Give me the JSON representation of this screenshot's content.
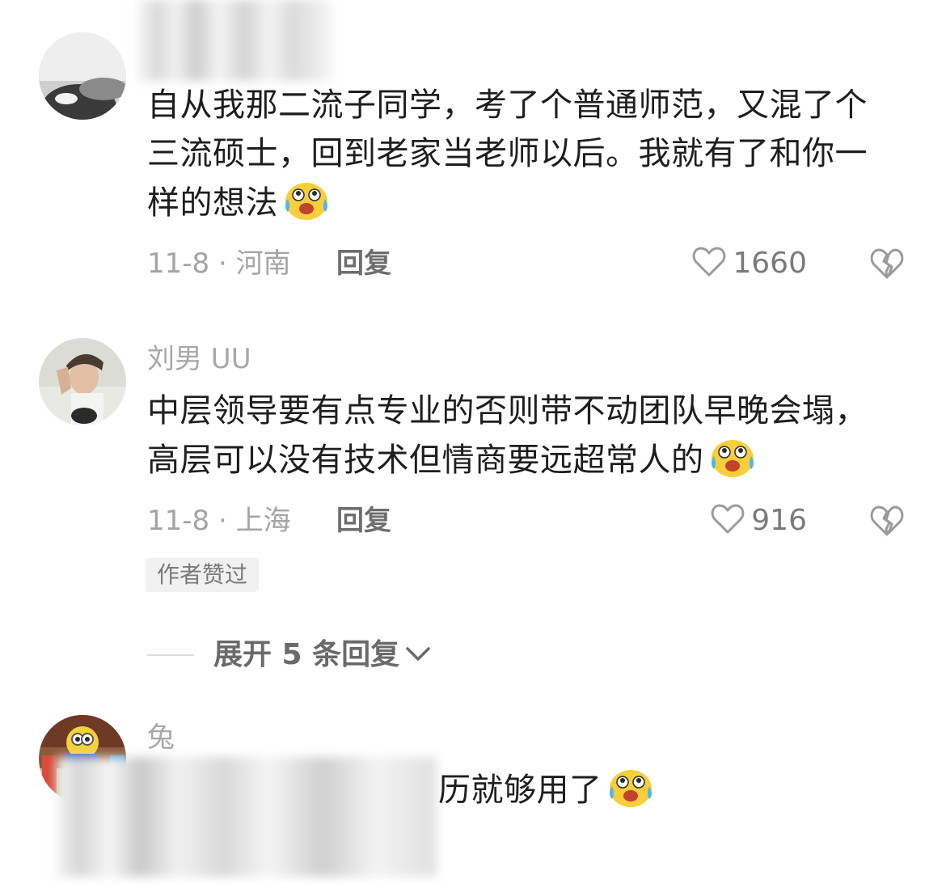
{
  "comments": [
    {
      "username": "",
      "text": "自从我那二流子同学，考了个普通师范，又混了个三流硕士，回到老家当老师以后。我就有了和你一样的想法",
      "emoji": "crying-laughing-emoji",
      "date_location": "11-8 · 河南",
      "reply_label": "回复",
      "likes": "1660"
    },
    {
      "username": "刘男 UU",
      "text": "中层领导要有点专业的否则带不动团队早晚会塌，高层可以没有技术但情商要远超常人的",
      "emoji": "crying-laughing-emoji",
      "date_location": "11-8 · 上海",
      "reply_label": "回复",
      "likes": "916",
      "badge": "作者赞过",
      "expand_label": "展开 5 条回复"
    },
    {
      "username": "兔",
      "text": "历就够用了",
      "emoji": "crying-laughing-emoji"
    }
  ],
  "colors": {
    "meta": "#a4a4a4",
    "username": "#a8a8a8",
    "body": "#1e1e1e",
    "badge_bg": "#f1f1f1"
  }
}
